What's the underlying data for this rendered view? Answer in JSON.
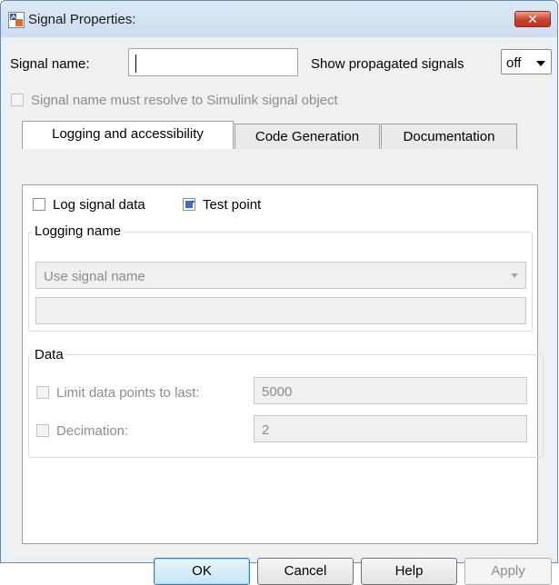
{
  "window": {
    "title": "Signal Properties:",
    "close_glyph": "✕"
  },
  "signal_name": {
    "label": "Signal name:",
    "value": ""
  },
  "propagated": {
    "label": "Show propagated signals",
    "selected": "off"
  },
  "resolve": {
    "label": "Signal name must resolve to Simulink signal object",
    "checked": false
  },
  "tabs": [
    {
      "label": "Logging and accessibility",
      "active": true
    },
    {
      "label": "Code Generation",
      "active": false
    },
    {
      "label": "Documentation",
      "active": false
    }
  ],
  "logging": {
    "log_signal_label": "Log signal data",
    "log_signal_checked": false,
    "test_point_label": "Test point",
    "test_point_checked": true,
    "group_title": "Logging name",
    "name_mode": "Use signal name",
    "name_value": ""
  },
  "data_group": {
    "title": "Data",
    "limit_label": "Limit data points to last:",
    "limit_value": "5000",
    "decimation_label": "Decimation:",
    "decimation_value": "2"
  },
  "buttons": {
    "ok": "OK",
    "cancel": "Cancel",
    "help": "Help",
    "apply": "Apply"
  }
}
